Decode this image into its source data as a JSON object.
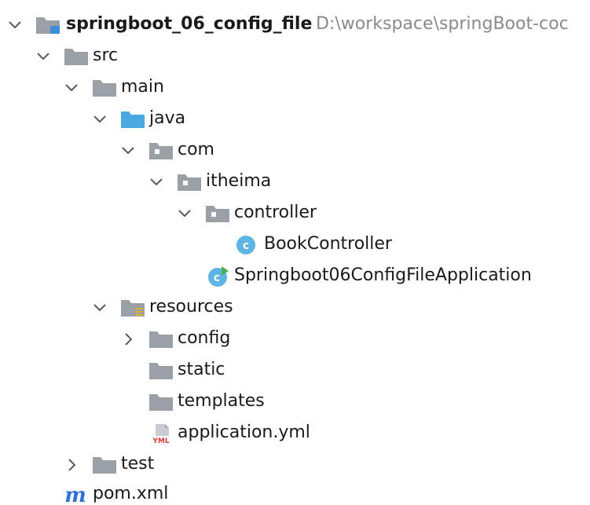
{
  "tree": {
    "root": {
      "label": "springboot_06_config_file",
      "path": "D:\\workspace\\springBoot-coc"
    },
    "src": "src",
    "main": "main",
    "java": "java",
    "com": "com",
    "itheima": "itheima",
    "controller": "controller",
    "book_controller": "BookController",
    "application_class": "Springboot06ConfigFileApplication",
    "resources": "resources",
    "config": "config",
    "static": "static",
    "templates": "templates",
    "application_yml": "application.yml",
    "test": "test",
    "pom": "pom.xml"
  },
  "icons": {
    "folder": "folder-icon",
    "module_folder": "module-folder-icon",
    "source_root": "source-root-folder-icon",
    "package": "package-icon",
    "resources_root": "resources-root-folder-icon",
    "class": "class-icon",
    "spring_class": "spring-boot-class-icon",
    "yml": "yml-file-icon",
    "maven": "maven-icon",
    "chevron_open": "chevron-down-icon",
    "chevron_closed": "chevron-right-icon"
  },
  "colors": {
    "folder": "#9aa0a6",
    "source_folder": "#4aa8e0",
    "class_circle": "#5fb4e6",
    "maven": "#2d6fd6",
    "yml_red": "#d83a3a",
    "path_text": "#8a8a8a"
  }
}
